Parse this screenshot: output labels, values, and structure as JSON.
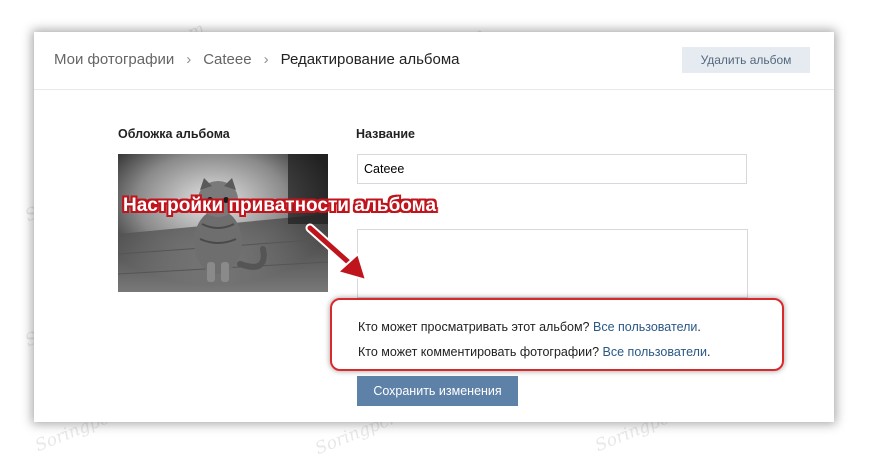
{
  "breadcrumb": {
    "items": [
      "Мои фотографии",
      "Cateee"
    ],
    "current": "Редактирование альбома",
    "separator": "›"
  },
  "header": {
    "delete_label": "Удалить альбом"
  },
  "cover": {
    "label": "Обложка альбома"
  },
  "name": {
    "label": "Название",
    "value": "Cateee"
  },
  "privacy": {
    "view_question": "Кто может просматривать этот альбом?",
    "view_value": "Все пользователи",
    "comment_question": "Кто может комментировать фотографии?",
    "comment_value": "Все пользователи",
    "period": "."
  },
  "save_label": "Сохранить изменения",
  "annotation": "Настройки приватности альбома",
  "watermark": "Soringpcrepair.com",
  "colors": {
    "accent": "#5e81a8",
    "link": "#2a5885",
    "highlight": "#d9292b"
  }
}
